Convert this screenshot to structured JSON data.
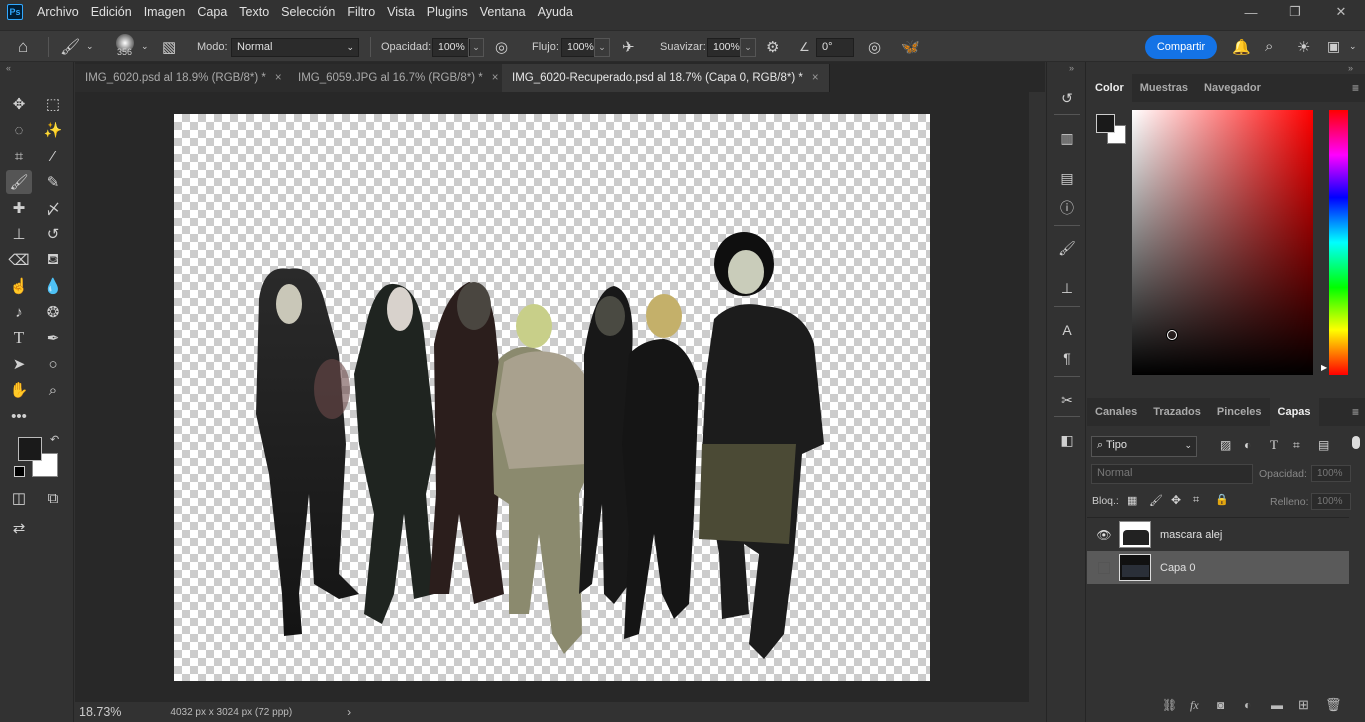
{
  "app": {
    "logo": "Ps"
  },
  "menu": [
    "Archivo",
    "Edición",
    "Imagen",
    "Capa",
    "Texto",
    "Selección",
    "Filtro",
    "Vista",
    "Plugins",
    "Ventana",
    "Ayuda"
  ],
  "options": {
    "brush_size": "356",
    "mode_label": "Modo:",
    "mode_value": "Normal",
    "opacity_label": "Opacidad:",
    "opacity_value": "100%",
    "flow_label": "Flujo:",
    "flow_value": "100%",
    "smooth_label": "Suavizar:",
    "smooth_value": "100%",
    "angle_value": "0°",
    "share_label": "Compartir"
  },
  "tabs": [
    {
      "label": "IMG_6020.psd al 18.9% (RGB/8*) *",
      "close": "×"
    },
    {
      "label": "IMG_6059.JPG al 16.7% (RGB/8*) *",
      "close": "×"
    },
    {
      "label": "IMG_6020-Recuperado.psd al 18.7% (Capa 0, RGB/8*) *",
      "close": "×"
    }
  ],
  "status": {
    "zoom": "18.73%",
    "doc_info": "4032 px x 3024 px (72 ppp)",
    "arrow": "›"
  },
  "color_panel": {
    "tabs": [
      "Color",
      "Muestras",
      "Navegador"
    ],
    "active": "Color",
    "fg_color": "#1a1a1a",
    "bg_color": "#ffffff",
    "hue_color": "#ff0000"
  },
  "layers_panel": {
    "tabs": [
      "Canales",
      "Trazados",
      "Pinceles",
      "Capas"
    ],
    "active": "Capas",
    "filter_label": "Tipo",
    "blend_mode": "Normal",
    "opacity_label": "Opacidad:",
    "opacity_value": "100%",
    "lock_label": "Bloq.:",
    "fill_label": "Relleno:",
    "fill_value": "100%",
    "layers": [
      {
        "name": "mascara alej",
        "visible": true,
        "selected": false
      },
      {
        "name": "Capa 0",
        "visible": false,
        "selected": true
      }
    ]
  },
  "icons": {
    "fx": "fx"
  }
}
